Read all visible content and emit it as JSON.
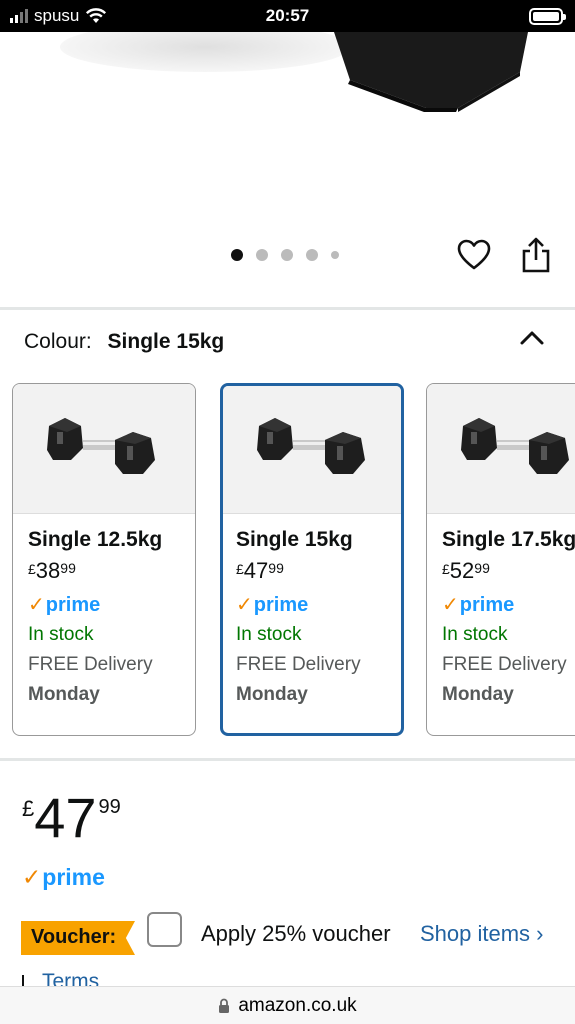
{
  "status_bar": {
    "carrier": "spusu",
    "time": "20:57"
  },
  "gallery": {
    "page_count": 5,
    "active_page": 1
  },
  "colour": {
    "label": "Colour:",
    "selected": "Single 15kg"
  },
  "variants": [
    {
      "name": "Single 12.5kg",
      "currency": "£",
      "price_whole": "38",
      "price_fraction": "99",
      "prime": "prime",
      "stock": "In stock",
      "delivery": "FREE Delivery",
      "day": "Monday",
      "selected": false
    },
    {
      "name": "Single 15kg",
      "currency": "£",
      "price_whole": "47",
      "price_fraction": "99",
      "prime": "prime",
      "stock": "In stock",
      "delivery": "FREE Delivery",
      "day": "Monday",
      "selected": true
    },
    {
      "name": "Single 17.5kg",
      "currency": "£",
      "price_whole": "52",
      "price_fraction": "99",
      "prime": "prime",
      "stock": "In stock",
      "delivery": "FREE Delivery",
      "day": "Monday",
      "selected": false
    }
  ],
  "price": {
    "currency": "£",
    "whole": "47",
    "fraction": "99",
    "prime": "prime"
  },
  "voucher": {
    "badge": "Voucher:",
    "text": "Apply 25% voucher",
    "link": "Shop items ›",
    "terms": "Terms"
  },
  "url_bar": {
    "domain": "amazon.co.uk"
  },
  "colors": {
    "link_blue": "#2162a1",
    "prime_blue": "#1a98ff",
    "in_stock_green": "#007600",
    "voucher_orange": "#f8a200"
  },
  "icons": [
    "wifi-icon",
    "battery-icon",
    "heart-icon",
    "share-icon",
    "chevron-up-icon",
    "lock-icon",
    "prime-check-icon"
  ]
}
